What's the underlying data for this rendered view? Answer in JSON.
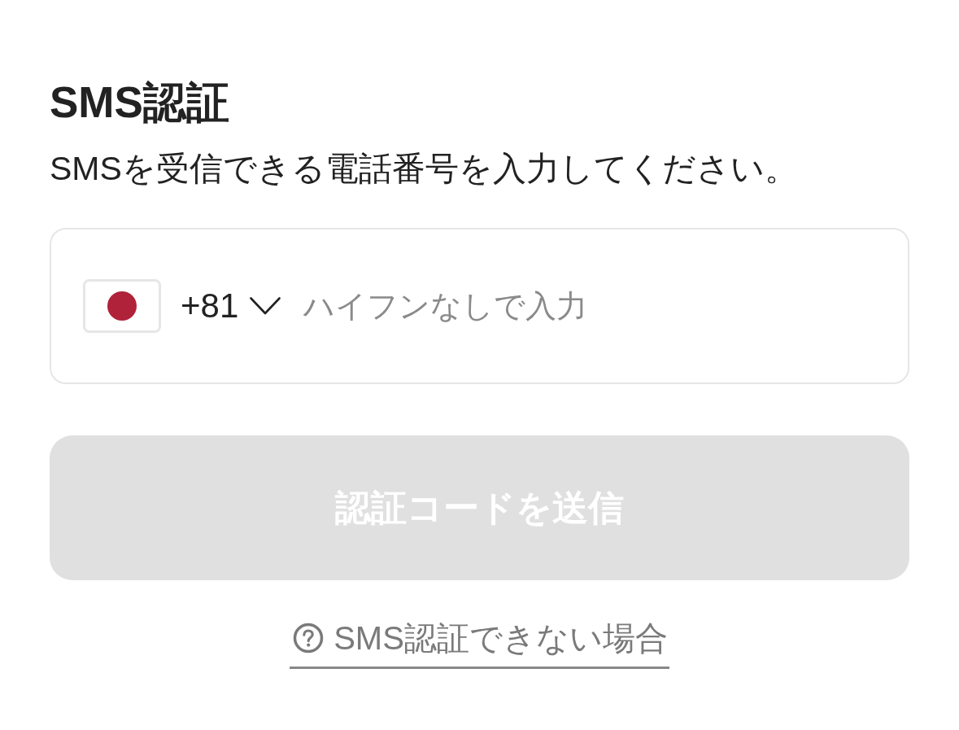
{
  "title": "SMS認証",
  "description": "SMSを受信できる電話番号を入力してください。",
  "phone_field": {
    "country_code": "+81",
    "placeholder": "ハイフンなしで入力"
  },
  "submit_button": {
    "label": "認証コードを送信",
    "disabled": true
  },
  "help_link": {
    "label": "SMS認証できない場合"
  }
}
